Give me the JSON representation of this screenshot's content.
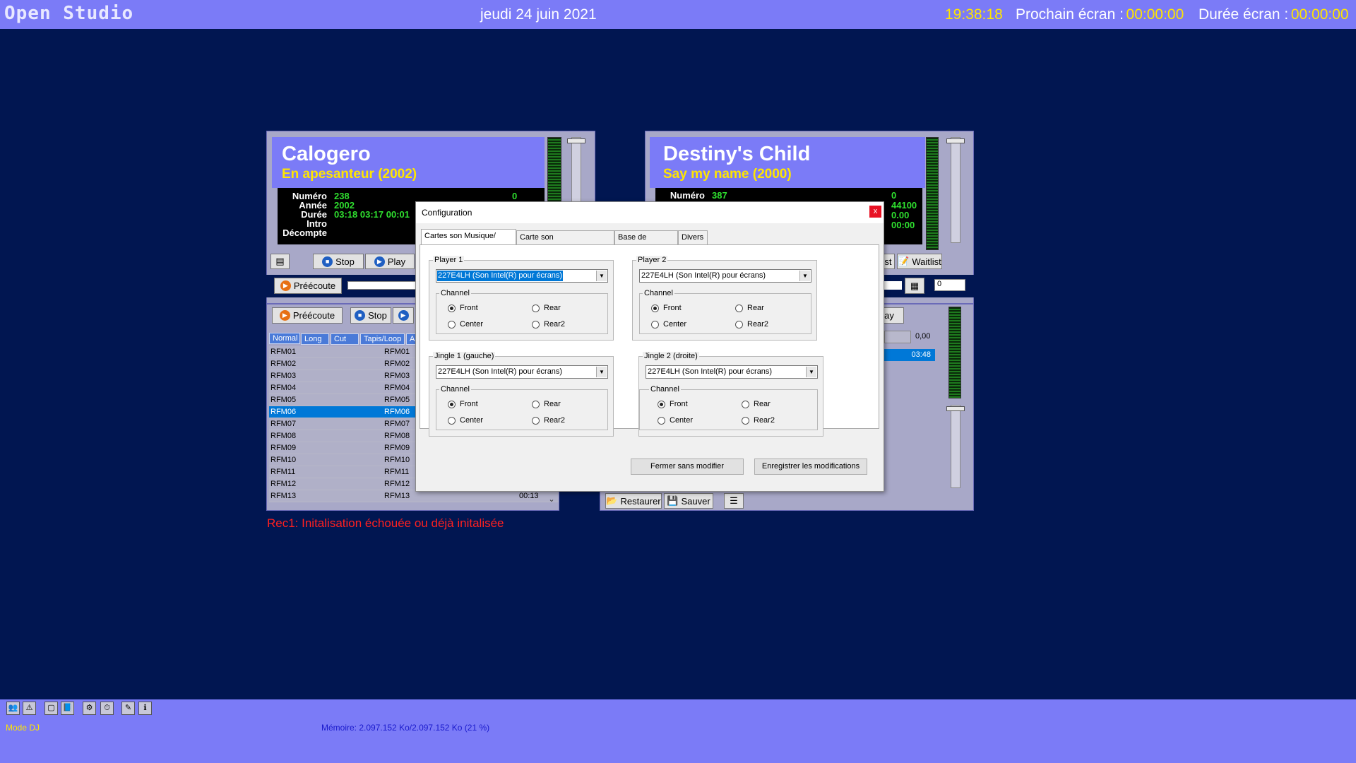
{
  "top_bar": {
    "app_title": "Open Studio",
    "date": "jeudi 24 juin 2021",
    "time": "19:38:18",
    "next_screen_label": "Prochain écran :",
    "next_screen_value": "00:00:00",
    "duration_label": "Durée écran :",
    "duration_value": "00:00:00"
  },
  "player1": {
    "artist": "Calogero",
    "song": "En apesanteur  (2002)",
    "labels": [
      "Numéro",
      "Année",
      "Durée",
      "Intro",
      "Décompte"
    ],
    "values": [
      "238",
      "2002",
      "03:18 03:17 00:01",
      "",
      ""
    ],
    "right_value": "0",
    "stop_label": "Stop",
    "play_label": "Play",
    "preecoute_label": "Préécoute"
  },
  "player2": {
    "artist": "Destiny's Child",
    "song": "Say my name  (2000)",
    "labels": [
      "Numéro"
    ],
    "values": [
      "387"
    ],
    "right_values": [
      "0",
      "44100",
      "0.00",
      "00:00"
    ],
    "waitlist_label": "Waitlist",
    "list_label_partial": "ist",
    "field_value": "0"
  },
  "lower_left": {
    "preecoute_label": "Préécoute",
    "stop_label": "Stop",
    "tabs": [
      "Normal",
      "Long",
      "Cut",
      "Tapis/Loop",
      "A"
    ],
    "rows": [
      {
        "a": "RFM01",
        "b": "RFM01"
      },
      {
        "a": "RFM02",
        "b": "RFM02"
      },
      {
        "a": "RFM03",
        "b": "RFM03"
      },
      {
        "a": "RFM04",
        "b": "RFM04"
      },
      {
        "a": "RFM05",
        "b": "RFM05"
      },
      {
        "a": "RFM06",
        "b": "RFM06"
      },
      {
        "a": "RFM07",
        "b": "RFM07"
      },
      {
        "a": "RFM08",
        "b": "RFM08"
      },
      {
        "a": "RFM09",
        "b": "RFM09"
      },
      {
        "a": "RFM10",
        "b": "RFM10"
      },
      {
        "a": "RFM11",
        "b": "RFM11"
      },
      {
        "a": "RFM12",
        "b": "RFM12"
      },
      {
        "a": "RFM13",
        "b": "RFM13",
        "c": "00:13"
      }
    ]
  },
  "lower_right": {
    "play_partial": "ay",
    "value": "0,00",
    "time": "03:48",
    "restore_label": "Restaurer",
    "save_label": "Sauver"
  },
  "error_message": "Rec1: Initalisation échouée ou déjà initalisée",
  "dialog": {
    "title": "Configuration",
    "close": "x",
    "tabs": [
      "Cartes son Musique/ Jingle",
      "Carte son Pub/Pad/Record",
      "Base de données",
      "Divers"
    ],
    "device": "227E4LH (Son Intel(R) pour écrans)",
    "channel_label": "Channel",
    "radio_labels": [
      "Front",
      "Rear",
      "Center",
      "Rear2"
    ],
    "groups": [
      {
        "title": "Player 1"
      },
      {
        "title": "Player 2"
      },
      {
        "title": "Jingle 1 (gauche)"
      },
      {
        "title": "Jingle 2 (droite)"
      }
    ],
    "close_no_change": "Fermer sans modifier",
    "save_changes": "Enregistrer les modifications"
  },
  "bottom_bar": {
    "mode": "Mode DJ",
    "memory": "Mémoire: 2.097.152 Ko/2.097.152 Ko (21 %)"
  }
}
